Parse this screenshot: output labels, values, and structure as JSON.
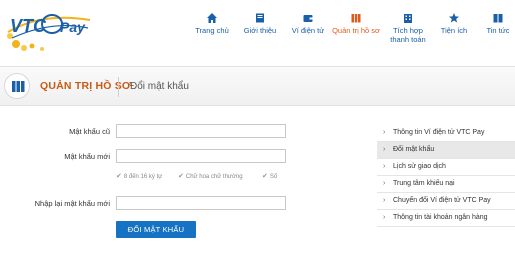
{
  "brand": {
    "logo_text_vtc": "VTC",
    "logo_text_pay": "Pay"
  },
  "nav": [
    {
      "id": "home",
      "label": "Trang chủ",
      "icon": "home-icon"
    },
    {
      "id": "about",
      "label": "Giới thiệu",
      "icon": "book-icon"
    },
    {
      "id": "wallet",
      "label": "Ví điện tử",
      "icon": "wallet-icon"
    },
    {
      "id": "account",
      "label": "Quản trị hồ sơ",
      "icon": "books-icon",
      "active": true
    },
    {
      "id": "integration",
      "label_line1": "Tích hợp",
      "label_line2": "thanh toán",
      "icon": "building-icon"
    },
    {
      "id": "utilities",
      "label": "Tiện ích",
      "icon": "star-icon"
    },
    {
      "id": "news",
      "label": "Tin tức",
      "icon": "newspaper-icon"
    }
  ],
  "titlebar": {
    "main": "QUẢN TRỊ HỒ SƠ",
    "sub": "Đổi mật khẩu"
  },
  "form": {
    "old_password_label": "Mật khẩu cũ",
    "new_password_label": "Mật khẩu mới",
    "confirm_password_label": "Nhập lại mật khẩu mới",
    "hints": [
      "8 đến 16 ký tự",
      "Chữ hoa chữ thường",
      "Số"
    ],
    "submit_label": "ĐỔI MẬT KHẨU"
  },
  "sidebar": {
    "items": [
      {
        "label": "Thông tin Ví điện tử VTC Pay",
        "active": false
      },
      {
        "label": "Đổi mật khẩu",
        "active": true
      },
      {
        "label": "Lịch sử giao dịch",
        "active": false
      },
      {
        "label": "Trung tâm khiếu nại",
        "active": false
      },
      {
        "label": "Chuyển đổi Ví điện tử VTC Pay",
        "active": false
      },
      {
        "label": "Thông tin tài khoản ngân hàng",
        "active": false
      }
    ]
  },
  "colors": {
    "nav_blue": "#1a5fa8",
    "active_orange": "#e05a1c",
    "button_blue": "#1673c4",
    "title_orange": "#c85a14"
  }
}
